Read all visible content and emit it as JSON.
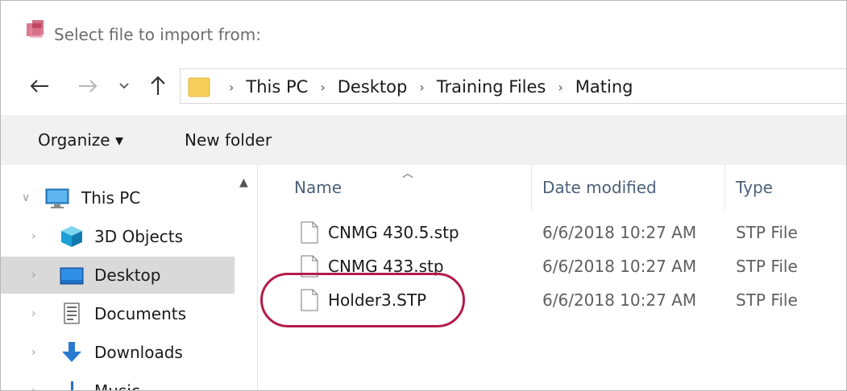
{
  "window": {
    "title": "Select file to import from:"
  },
  "address": {
    "breadcrumbs": [
      "This PC",
      "Desktop",
      "Training Files",
      "Mating"
    ]
  },
  "commands": {
    "organize_label": "Organize ▾",
    "new_folder_label": "New folder"
  },
  "nav_pane": {
    "items": [
      {
        "label": "This PC",
        "icon": "computer-icon"
      },
      {
        "label": "3D Objects",
        "icon": "cube-icon"
      },
      {
        "label": "Desktop",
        "icon": "desktop-icon",
        "selected": true
      },
      {
        "label": "Documents",
        "icon": "document-icon"
      },
      {
        "label": "Downloads",
        "icon": "download-arrow-icon"
      },
      {
        "label": "Music",
        "icon": "music-note-icon"
      }
    ]
  },
  "file_list": {
    "columns": [
      "Name",
      "Date modified",
      "Type"
    ],
    "rows": [
      {
        "name": "CNMG 430.5.stp",
        "date": "6/6/2018 10:27 AM",
        "type": "STP File"
      },
      {
        "name": "CNMG 433.stp",
        "date": "6/6/2018 10:27 AM",
        "type": "STP File"
      },
      {
        "name": "Holder3.STP",
        "date": "6/6/2018 10:27 AM",
        "type": "STP File",
        "annotated": true
      }
    ]
  },
  "colors": {
    "annotation": "#b41c4a",
    "column_header": "#4c607a",
    "selected_nav": "#d9d9d9"
  }
}
